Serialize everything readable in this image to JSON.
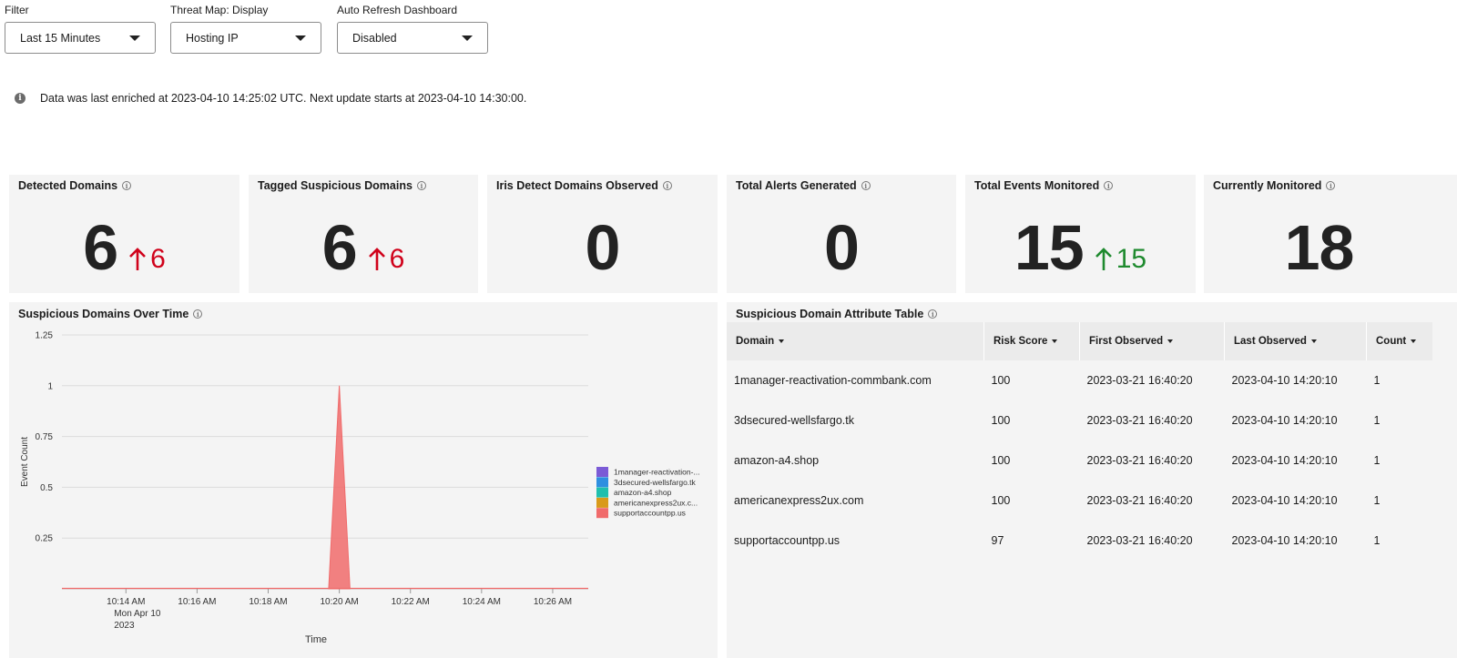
{
  "filters": [
    {
      "label": "Filter",
      "value": "Last 15 Minutes"
    },
    {
      "label": "Threat Map: Display",
      "value": "Hosting IP"
    },
    {
      "label": "Auto Refresh Dashboard",
      "value": "Disabled"
    }
  ],
  "info": {
    "text": "Data was last enriched at 2023-04-10 14:25:02 UTC. Next update starts at 2023-04-10 14:30:00."
  },
  "kpis": [
    {
      "title": "Detected Domains",
      "value": "6",
      "delta": "6",
      "delta_dir": "up",
      "delta_color": "#d0021b"
    },
    {
      "title": "Tagged Suspicious Domains",
      "value": "6",
      "delta": "6",
      "delta_dir": "up",
      "delta_color": "#d0021b"
    },
    {
      "title": "Iris Detect Domains Observed",
      "value": "0"
    },
    {
      "title": "Total Alerts Generated",
      "value": "0"
    },
    {
      "title": "Total Events Monitored",
      "value": "15",
      "delta": "15",
      "delta_dir": "up",
      "delta_color": "#1e8a2e"
    },
    {
      "title": "Currently Monitored",
      "value": "18"
    }
  ],
  "chart_panel": {
    "title": "Suspicious Domains Over Time"
  },
  "chart_data": {
    "type": "area",
    "xlabel": "Time",
    "ylabel": "Event Count",
    "ylim": [
      0,
      1.25
    ],
    "yticks": [
      "0.25",
      "0.5",
      "0.75",
      "1",
      "1.25"
    ],
    "xticks": [
      {
        "label": "10:14 AM",
        "sub": [
          "Mon Apr 10",
          "2023"
        ]
      },
      {
        "label": "10:16 AM"
      },
      {
        "label": "10:18 AM"
      },
      {
        "label": "10:20 AM"
      },
      {
        "label": "10:22 AM"
      },
      {
        "label": "10:24 AM"
      },
      {
        "label": "10:26 AM"
      }
    ],
    "x_range_minutes": [
      12.2,
      27.0
    ],
    "series": [
      {
        "name": "1manager-reactivation-...",
        "color": "#7b5bd6",
        "points": []
      },
      {
        "name": "3dsecured-wellsfargo.tk",
        "color": "#2f8fe0",
        "points": []
      },
      {
        "name": "amazon-a4.shop",
        "color": "#20bfae",
        "points": []
      },
      {
        "name": "americanexpress2ux.c...",
        "color": "#d99a1a",
        "points": []
      },
      {
        "name": "supportaccountpp.us",
        "color": "#f06b6b",
        "points": [
          [
            19.7,
            0
          ],
          [
            20.0,
            1
          ],
          [
            20.3,
            0
          ]
        ]
      }
    ],
    "legend_position": "right"
  },
  "table_panel": {
    "title": "Suspicious Domain Attribute Table",
    "columns": [
      "Domain",
      "Risk Score",
      "First Observed",
      "Last Observed",
      "Count"
    ],
    "rows": [
      [
        "1manager-reactivation-commbank.com",
        "100",
        "2023-03-21 16:40:20",
        "2023-04-10 14:20:10",
        "1"
      ],
      [
        "3dsecured-wellsfargo.tk",
        "100",
        "2023-03-21 16:40:20",
        "2023-04-10 14:20:10",
        "1"
      ],
      [
        "amazon-a4.shop",
        "100",
        "2023-03-21 16:40:20",
        "2023-04-10 14:20:10",
        "1"
      ],
      [
        "americanexpress2ux.com",
        "100",
        "2023-03-21 16:40:20",
        "2023-04-10 14:20:10",
        "1"
      ],
      [
        "supportaccountpp.us",
        "97",
        "2023-03-21 16:40:20",
        "2023-04-10 14:20:10",
        "1"
      ]
    ]
  }
}
